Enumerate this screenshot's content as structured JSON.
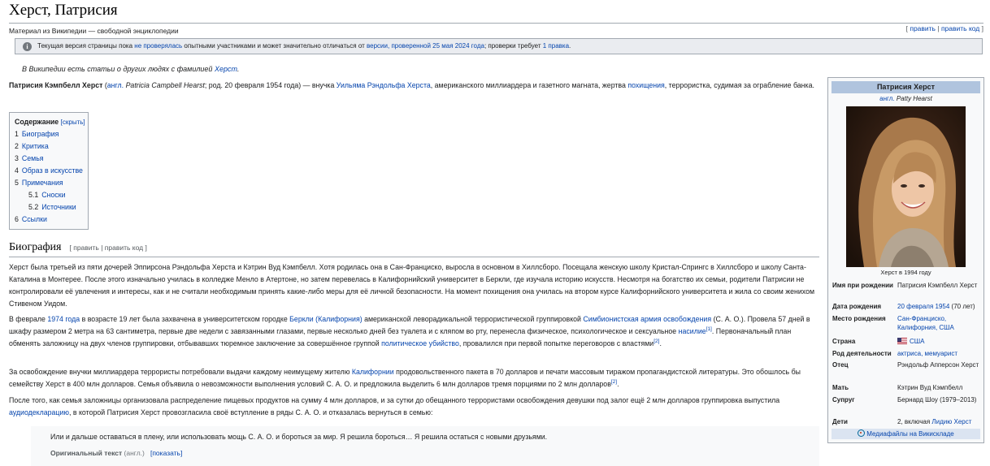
{
  "header": {
    "title": "Херст, Патрисия",
    "subtitle": "Материал из Википедии — свободной энциклопедии",
    "edit_open": "[ ",
    "edit_link": "править",
    "edit_sep": " | ",
    "edit_code_link": "править код",
    "edit_close": " ]"
  },
  "notice": {
    "icon": "info-icon",
    "t1": "Текущая версия страницы пока ",
    "link1": "не проверялась",
    "t2": " опытными участниками и может значительно отличаться от ",
    "link2": "версии, проверенной 25 мая 2024 года",
    "t3": "; проверки требует ",
    "link3": "1 правка",
    "t4": "."
  },
  "hatnote": {
    "t1": "В Википедии есть статьи о других людях с фамилией ",
    "link": "Херст",
    "t2": "."
  },
  "lead": {
    "name": "Патрисия Кэмпбелл Херст",
    "t1": " (",
    "lang": "англ.",
    "orig": " Patricia Campbell Hearst",
    "t2": "; род. 20 февраля 1954 года) — внучка ",
    "link1": "Уильяма Рэндольфа Херста",
    "t3": ", американского миллиардера и газетного магната, жертва ",
    "link2": "похищения",
    "t4": ", террористка, судимая за ограбление банка."
  },
  "toc": {
    "title": "Содержание",
    "hide": "[скрыть]",
    "items": [
      {
        "num": "1",
        "label": "Биография"
      },
      {
        "num": "2",
        "label": "Критика"
      },
      {
        "num": "3",
        "label": "Семья"
      },
      {
        "num": "4",
        "label": "Образ в искусстве"
      },
      {
        "num": "5",
        "label": "Примечания"
      },
      {
        "num": "5.1",
        "label": "Сноски"
      },
      {
        "num": "5.2",
        "label": "Источники"
      },
      {
        "num": "6",
        "label": "Ссылки"
      }
    ]
  },
  "bio": {
    "heading": "Биография",
    "edit": "[ править | править код ]",
    "p1": "Херст была третьей из пяти дочерей Эппирсона Рэндольфа Херста и Кэтрин Вуд Кэмпбелл. Хотя родилась она в Сан-Франциско, выросла в основном в Хиллсборо. Посещала женскую школу Кристал-Спрингс в Хиллсборо и школу Санта-Каталина в Монтерее. После этого изначально училась в колледже Менло в Атертоне, но затем перевелась в Калифорнийский университет в Беркли, где изучала историю искусств. Несмотря на богатство их семьи, родители Патрисии не контролировали её увлечения и интересы, как и не считали необходимым принять какие-либо меры для её личной безопасности. На момент похищения она училась на втором курсе Калифорнийского университета и жила со своим женихом Стивеном Уидом.",
    "p2_t1": "В феврале ",
    "p2_l1": "1974 года",
    "p2_t2": " в возрасте 19 лет была захвачена в университетском городке ",
    "p2_l2": "Беркли (Калифорния)",
    "p2_t3": " американской леворадикальной террористической группировкой ",
    "p2_l3": "Симбионистская армия освобождения",
    "p2_t4": " (С. А. О.). Провела 57 дней в шкафу размером 2 метра на 63 сантиметра, первые две недели с завязанными глазами, первые несколько дней без туалета и с кляпом во рту, перенесла физическое, психологическое и сексуальное ",
    "p2_l4": "насилие",
    "p2_s1": "[1]",
    "p2_t5": ". Первоначальный план обменять заложницу на двух членов группировки, отбывавших тюремное заключение за совершённое группой ",
    "p2_l5": "политическое убийство",
    "p2_t6": ", провалился при первой попытке переговоров с властями",
    "p2_s2": "[2]",
    "p2_t7": ".",
    "p3_t1": "За освобождение внучки миллиардера террористы потребовали выдачи каждому неимущему жителю ",
    "p3_l1": "Калифорнии",
    "p3_t2": " продовольственного пакета в 70 долларов и печати массовым тиражом пропагандистской литературы. Это обошлось бы семейству Херст в 400 млн долларов. Семья объявила о невозможности выполнения условий С. А. О. и предложила выделить 6 млн долларов тремя порциями по 2 млн долларов",
    "p3_s1": "[2]",
    "p3_t3": ".",
    "p4_t1": "После того, как семья заложницы организовала распределение пищевых продуктов на сумму 4 млн долларов, и за сутки до обещанного террористами освобождения девушки под залог ещё 2 млн долларов группировка выпустила ",
    "p4_l1": "аудиодекларацию",
    "p4_t2": ", в которой Патрисия Херст провозгласила своё вступление в ряды С. А. О. и отказалась вернуться в семью:"
  },
  "quote": {
    "text": "Или и дальше оставаться в плену, или использовать мощь С. А. О. и бороться за мир. Я решила бороться… Я решила остаться с новыми друзьями.",
    "orig_label": "Оригинальный текст",
    "orig_lang": " (англ.)",
    "show": "[показать]"
  },
  "infobox": {
    "title": "Патрисия Херст",
    "orig_lang": "англ.",
    "orig_name": " Patty Hearst",
    "caption": "Херст в 1994 году",
    "rows": [
      {
        "label": "Имя при рождении",
        "value": "Патрисия Кэмпбелл Херст"
      },
      {
        "label": "Дата рождения",
        "link": "20 февраля 1954",
        "value": " (70 лет)"
      },
      {
        "label": "Место рождения",
        "link": "Сан-Франциско, Калифорния, США"
      },
      {
        "label": "Страна",
        "link": "США",
        "flag": "usa-flag-icon"
      },
      {
        "label": "Род деятельности",
        "link": "актриса, мемуарист"
      },
      {
        "label": "Отец",
        "value": "Рэндольф Апперсон Херст"
      },
      {
        "label": "Мать",
        "value": "Кэтрин Вуд Кэмпбелл"
      },
      {
        "label": "Супруг",
        "value": "Бернард Шоу (1979–2013)"
      },
      {
        "label": "Дети",
        "value": "2, включая ",
        "link": "Лидию Херст"
      }
    ],
    "media": "Медиафайлы на Викискладе"
  }
}
